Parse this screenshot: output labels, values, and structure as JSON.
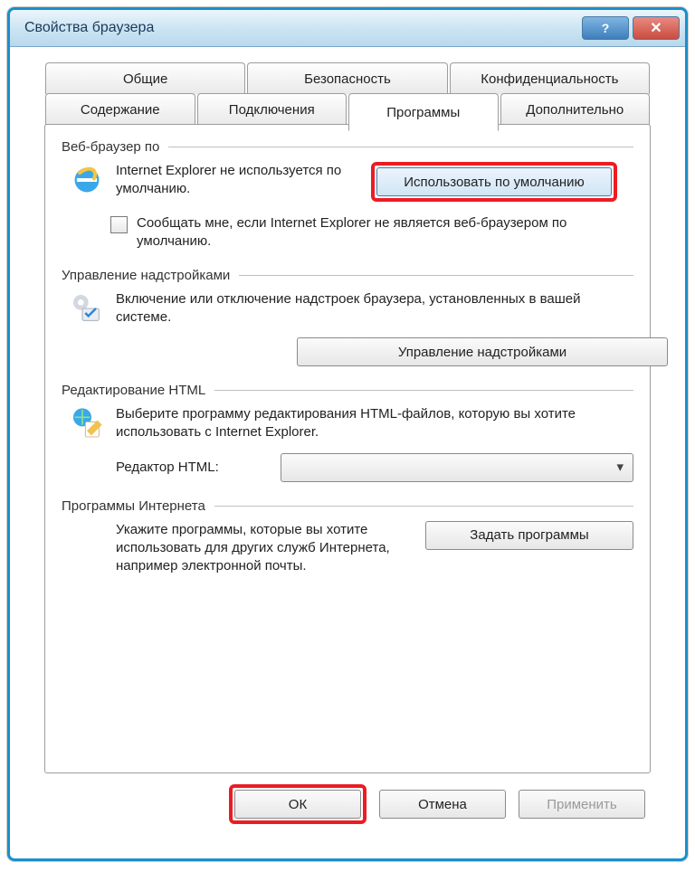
{
  "window": {
    "title": "Свойства браузера"
  },
  "tabs": {
    "row1": [
      "Общие",
      "Безопасность",
      "Конфиденциальность"
    ],
    "row2": [
      "Содержание",
      "Подключения",
      "Программы",
      "Дополнительно"
    ],
    "active": "Программы"
  },
  "groups": {
    "browser": {
      "title": "Веб-браузер по",
      "status": "Internet Explorer не используется по умолчанию.",
      "set_default_btn": "Использовать по умолчанию",
      "notify_label": "Сообщать мне, если Internet Explorer не является веб-браузером по умолчанию."
    },
    "addons": {
      "title": "Управление надстройками",
      "desc": "Включение или отключение надстроек браузера, установленных в вашей системе.",
      "btn": "Управление надстройками"
    },
    "html": {
      "title": "Редактирование HTML",
      "desc": "Выберите программу редактирования HTML-файлов, которую вы хотите использовать с Internet Explorer.",
      "editor_label": "Редактор HTML:",
      "editor_value": ""
    },
    "programs": {
      "title": "Программы Интернета",
      "desc": "Укажите программы, которые вы хотите использовать для других служб Интернета, например электронной почты.",
      "btn": "Задать программы"
    }
  },
  "footer": {
    "ok": "ОК",
    "cancel": "Отмена",
    "apply": "Применить"
  }
}
